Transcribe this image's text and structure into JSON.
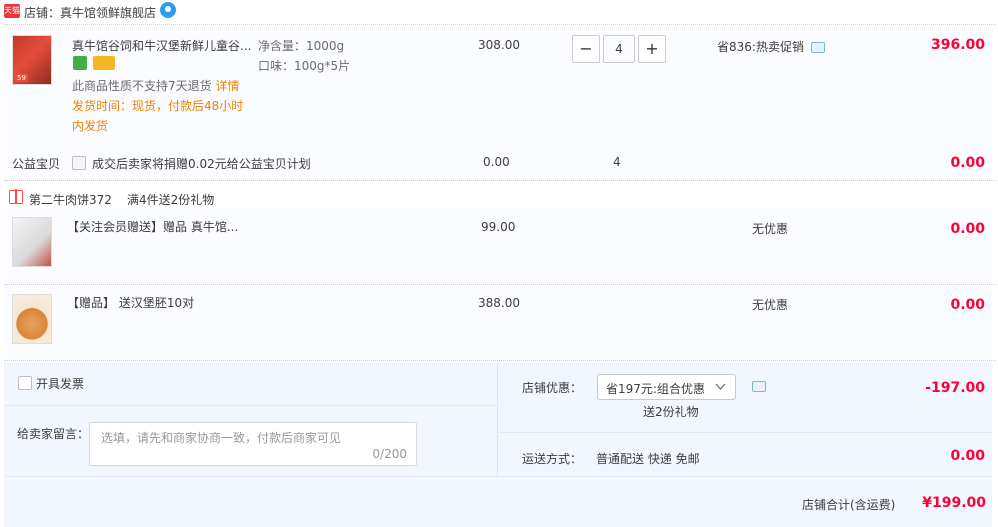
{
  "shop": {
    "badge": "天猫",
    "name": "店铺：真牛馆领鲜旗舰店"
  },
  "main_item": {
    "title": "真牛馆谷饲和牛汉堡新鲜儿童谷...",
    "spec_net": "净含量：1000g",
    "spec_taste": "口味：100g*5片",
    "return_note": "此商品性质不支持7天退货",
    "detail_link": "详情",
    "ship_line1": "发货时间：现货，付款后48小时",
    "ship_line2": "内发货",
    "unit_price": "308.00",
    "quantity": "4",
    "promo": "省836:热卖促销",
    "subtotal": "396.00",
    "thumb_tag": "59"
  },
  "charity": {
    "label": "公益宝贝",
    "text": "成交后卖家将捐赠0.02元给公益宝贝计划",
    "price": "0.00",
    "quantity": "4",
    "subtotal": "0.00"
  },
  "gift_group": {
    "title": "第二牛肉饼372",
    "rule": "满4件送2份礼物"
  },
  "gifts": [
    {
      "title": "【关注会员赠送】赠品 真牛馆...",
      "price": "99.00",
      "promo": "无优惠",
      "subtotal": "0.00"
    },
    {
      "title": "【赠品】 送汉堡胚10对",
      "price": "388.00",
      "promo": "无优惠",
      "subtotal": "0.00"
    }
  ],
  "invoice": {
    "label": "开具发票"
  },
  "message": {
    "label": "给卖家留言：",
    "placeholder": "选填，请先和商家协商一致，付款后商家可见",
    "counter": "0/200"
  },
  "shop_discount": {
    "label": "店铺优惠：",
    "selected": "省197元:组合优惠",
    "gift_note": "送2份礼物",
    "amount": "-197.00"
  },
  "shipping": {
    "label": "运送方式：",
    "method": "普通配送 快递 免邮",
    "amount": "0.00"
  },
  "shop_total": {
    "label": "店铺合计(含运费)",
    "amount": "¥199.00"
  },
  "colors": {
    "price_red": "#ff0036",
    "orange": "#f08200",
    "bottom_bg": "#f2f7ff"
  }
}
